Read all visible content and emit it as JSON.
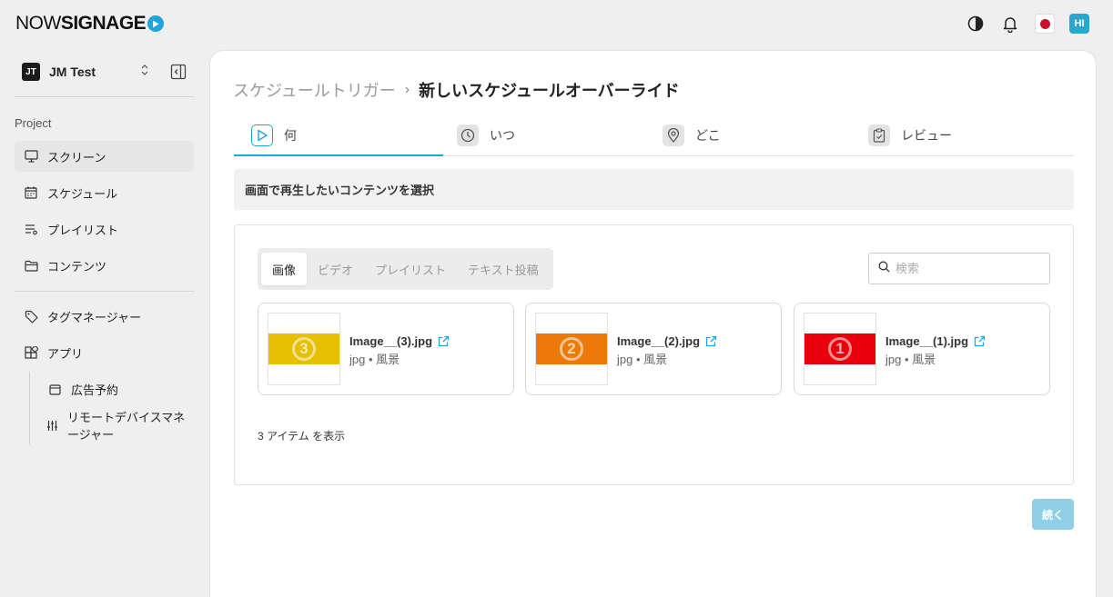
{
  "brand": {
    "logo_light": "NOW",
    "logo_bold": "SIGNAGE"
  },
  "topbar": {
    "avatar": "HI"
  },
  "workspace": {
    "badge": "JT",
    "name": "JM Test"
  },
  "sidebar": {
    "section_label": "Project",
    "items": [
      {
        "label": "スクリーン",
        "icon": "monitor-icon"
      },
      {
        "label": "スケジュール",
        "icon": "calendar-icon"
      },
      {
        "label": "プレイリスト",
        "icon": "playlist-icon"
      },
      {
        "label": "コンテンツ",
        "icon": "folder-icon"
      },
      {
        "label": "タグマネージャー",
        "icon": "tag-icon"
      },
      {
        "label": "アプリ",
        "icon": "apps-icon"
      },
      {
        "label": "広告予約",
        "icon": "calendar-small-icon"
      },
      {
        "label": "リモートデバイスマネージャー",
        "icon": "sliders-icon"
      }
    ]
  },
  "breadcrumb": {
    "parent": "スケジュールトリガー",
    "separator": "›",
    "current": "新しいスケジュールオーバーライド"
  },
  "steps": [
    {
      "label": "何",
      "icon": "play-icon",
      "active": true
    },
    {
      "label": "いつ",
      "icon": "clock-icon"
    },
    {
      "label": "どこ",
      "icon": "location-icon"
    },
    {
      "label": "レビュー",
      "icon": "clipboard-check-icon"
    }
  ],
  "prompt": "画面で再生したいコンテンツを選択",
  "content_tabs": [
    {
      "label": "画像",
      "active": true
    },
    {
      "label": "ビデオ"
    },
    {
      "label": "プレイリスト"
    },
    {
      "label": "テキスト投稿"
    }
  ],
  "search": {
    "placeholder": "検索",
    "value": ""
  },
  "items": [
    {
      "name": "Image__(3).jpg",
      "meta": "jpg • 風景",
      "thumb_color": "#e6bf00",
      "thumb_number": "3"
    },
    {
      "name": "Image__(2).jpg",
      "meta": "jpg • 風景",
      "thumb_color": "#ec7a08",
      "thumb_number": "2"
    },
    {
      "name": "Image__(1).jpg",
      "meta": "jpg • 風景",
      "thumb_color": "#e8000b",
      "thumb_number": "1"
    }
  ],
  "count_text": "3 アイテム を表示",
  "continue_button": "続く",
  "colors": {
    "accent": "#1ea5d9",
    "button_disabled": "#8fd0e6"
  }
}
